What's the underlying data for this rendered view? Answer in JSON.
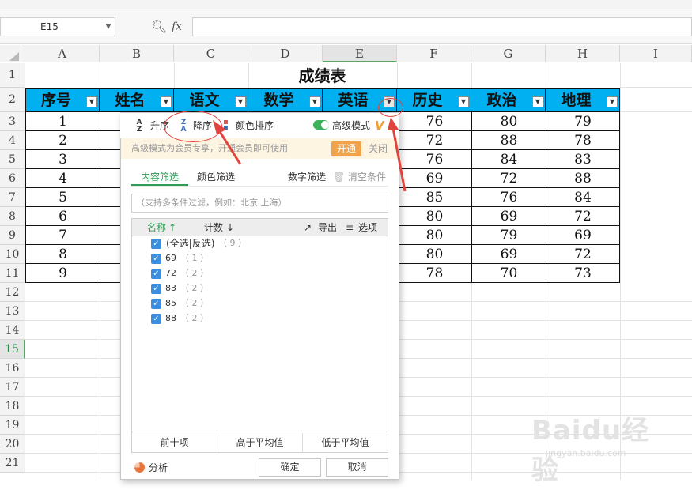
{
  "toolbar": {
    "name_box": "E15",
    "fx_label": "fx",
    "formula_value": ""
  },
  "columns": [
    "A",
    "B",
    "C",
    "D",
    "E",
    "F",
    "G",
    "H",
    "I"
  ],
  "rows": [
    "1",
    "2",
    "3",
    "4",
    "5",
    "6",
    "7",
    "8",
    "9",
    "10",
    "11",
    "12",
    "13",
    "14",
    "15",
    "16",
    "17",
    "18",
    "19",
    "20",
    "21"
  ],
  "selected_column": "E",
  "selected_row": "15",
  "sheet": {
    "title": "成绩表",
    "headers": [
      "序号",
      "姓名",
      "语文",
      "数学",
      "英语",
      "历史",
      "政治",
      "地理"
    ],
    "serials": [
      "1",
      "2",
      "3",
      "4",
      "5",
      "6",
      "7",
      "8",
      "9"
    ],
    "history": [
      "76",
      "72",
      "76",
      "69",
      "85",
      "80",
      "80",
      "80",
      "78"
    ],
    "politics": [
      "80",
      "88",
      "84",
      "72",
      "76",
      "69",
      "79",
      "69",
      "70"
    ],
    "geography": [
      "79",
      "78",
      "83",
      "88",
      "84",
      "72",
      "69",
      "72",
      "73"
    ]
  },
  "filter_panel": {
    "sort_asc": "升序",
    "sort_desc": "降序",
    "color_sort": "颜色排序",
    "advanced_mode": "高级模式",
    "vip_notice": "高级模式为会员专享，开通会员即可使用",
    "open_button": "开通",
    "close_link": "关闭",
    "tab_content": "内容筛选",
    "tab_color": "颜色筛选",
    "number_filter": "数字筛选",
    "clear_conditions": "清空条件",
    "search_placeholder": "（支持多条件过滤，例如：北京  上海）",
    "col_name": "名称",
    "col_count": "计数",
    "export": "导出",
    "options": "选项",
    "select_all": "(全选|反选)",
    "select_all_count": "（ 9 ）",
    "items": [
      {
        "value": "69",
        "count": "（ 1 ）",
        "checked": true
      },
      {
        "value": "72",
        "count": "（ 2 ）",
        "checked": true
      },
      {
        "value": "83",
        "count": "（ 2 ）",
        "checked": true
      },
      {
        "value": "85",
        "count": "（ 2 ）",
        "checked": true
      },
      {
        "value": "88",
        "count": "（ 2 ）",
        "checked": true
      }
    ],
    "top_ten": "前十项",
    "above_avg": "高于平均值",
    "below_avg": "低于平均值",
    "analysis": "分析",
    "ok": "确定",
    "cancel": "取消"
  },
  "watermark": {
    "brand": "Baidu经验",
    "url": "jingyan.baidu.com"
  },
  "colors": {
    "header_fill": "#00b0f0",
    "accent_green": "#2e9c54",
    "annotation_red": "#e0443e",
    "vip_orange": "#f0a34a"
  }
}
